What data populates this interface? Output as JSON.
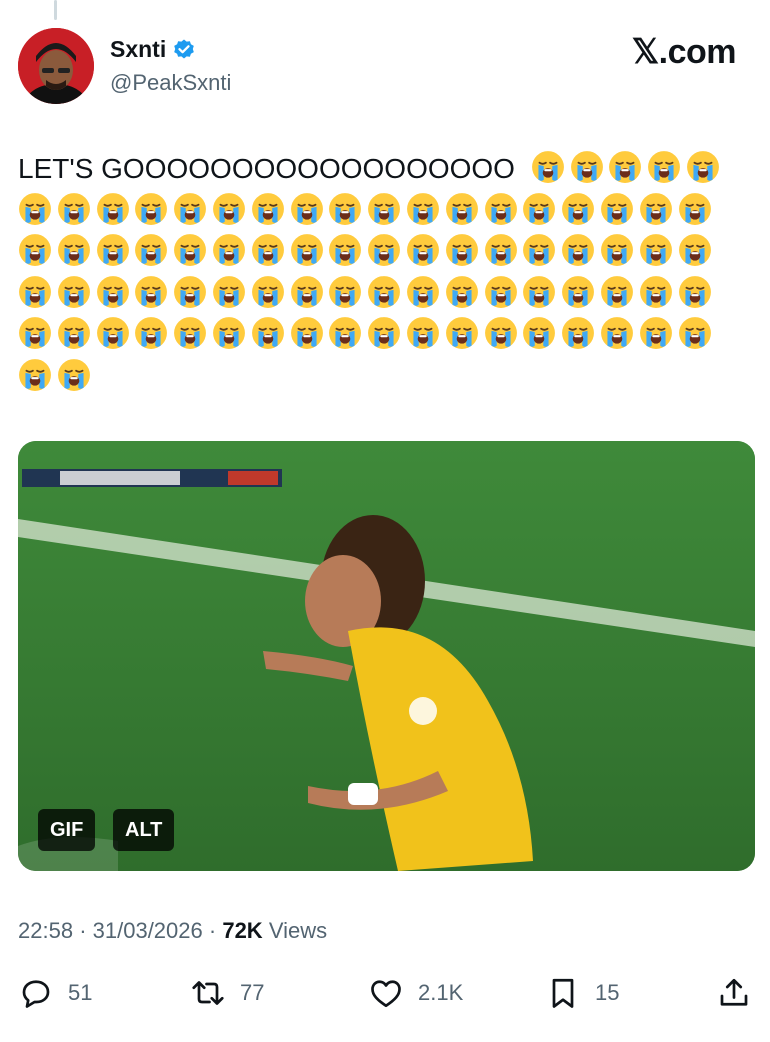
{
  "author": {
    "display_name": "Sxnti",
    "handle": "@PeakSxnti",
    "verified": true
  },
  "site": {
    "brand": "𝕏.com"
  },
  "tweet": {
    "text": "LET'S GOOOOOOOOOOOOOOOOOO",
    "emoji": "loudly-crying-face",
    "emoji_count": 79
  },
  "media": {
    "gif_badge": "GIF",
    "alt_badge": "ALT"
  },
  "meta": {
    "time": "22:58",
    "separator": "·",
    "date": "31/03/2026",
    "views_count": "72K",
    "views_label": "Views"
  },
  "actions": {
    "replies": "51",
    "reposts": "77",
    "likes": "2.1K",
    "bookmarks": "15"
  },
  "colors": {
    "verified": "#1d9bf0",
    "secondary_text": "#536471",
    "primary_text": "#0f1419"
  }
}
